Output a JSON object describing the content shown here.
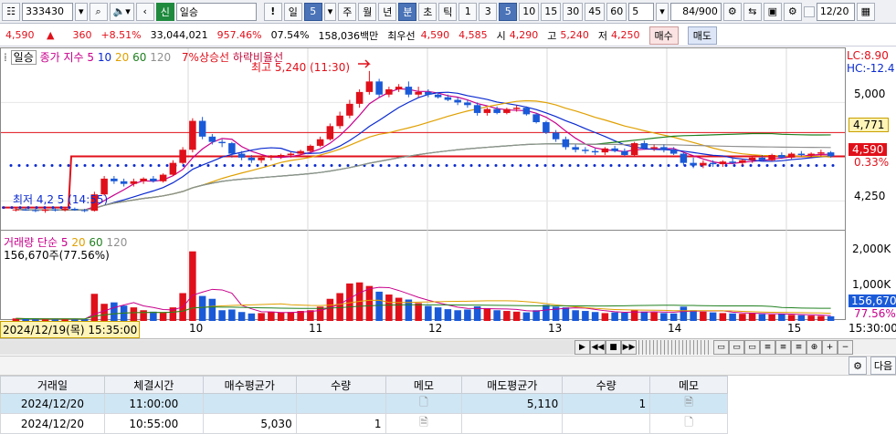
{
  "toolbar": {
    "code": "333430",
    "search_icon": "magnifier-icon",
    "market_badge": "신",
    "name": "일승",
    "period_label": "일",
    "period_value": "5",
    "tabs": [
      "주",
      "월",
      "년",
      "분",
      "초",
      "틱"
    ],
    "active_tab": "분",
    "intervals": [
      "1",
      "3",
      "5",
      "10",
      "15",
      "30",
      "45",
      "60"
    ],
    "active_interval": "5",
    "interval_value": "5",
    "count": "84",
    "count_total": "/900",
    "date": "12/20"
  },
  "priceline": {
    "price": "4,590",
    "change": "360",
    "change_pct": "+8.51%",
    "volume": "33,044,021",
    "volume_ratio": "957.46%",
    "turnover": "07.54%",
    "amount": "158,036백만",
    "best_label": "최우선",
    "best_sell": "4,590",
    "best_buy": "4,585",
    "open_label": "시",
    "open": "4,290",
    "high_label": "고",
    "high": "5,240",
    "low_label": "저",
    "low": "4,250",
    "buy_label": "매수",
    "sell_label": "매도"
  },
  "chart": {
    "name_label": "일승",
    "legend_main": "종가 지수",
    "ma_periods": [
      "5",
      "10",
      "20",
      "60",
      "120"
    ],
    "ma_colors": [
      "#c8008c",
      "#0a2ad0",
      "#e0a000",
      "#208020",
      "#909090"
    ],
    "signal_label": "7%상승선",
    "signal2_label": "하락비율선",
    "high_annotation": "최고 5,240 (11:30)",
    "low_annotation": "최저 4,2 5 (14:55)",
    "lc_label": "LC:8.90",
    "hc_label": "HC:-12.4",
    "y_ticks": [
      "5,000",
      "4,250"
    ],
    "price_tag_1": "4,771",
    "price_tag_2": "4,590",
    "pct_tag": "0.33%",
    "volume_legend": "거래량 단순",
    "volume_periods": [
      "5",
      "20",
      "60",
      "120"
    ],
    "volume_info": "156,670주(77.56%)",
    "volume_ticks": [
      "2,000K",
      "1,000K"
    ],
    "volume_tag": "156,670",
    "volume_pct_tag": "77.56%",
    "cursor_datetime": "2024/12/19(목) 15:35:00",
    "x_dates": [
      "10",
      "11",
      "12",
      "13",
      "14",
      "15"
    ],
    "time_tag": "15:30:00",
    "up_color": "#e0101a",
    "down_color": "#1a5ad8"
  },
  "chart_data": {
    "type": "candlestick",
    "candles": [
      [
        4180,
        4195,
        4170,
        4185
      ],
      [
        4185,
        4200,
        4175,
        4180
      ],
      [
        4180,
        4190,
        4165,
        4175
      ],
      [
        4175,
        4190,
        4160,
        4185
      ],
      [
        4185,
        4195,
        4170,
        4180
      ],
      [
        4180,
        4195,
        4170,
        4190
      ],
      [
        4190,
        4200,
        4175,
        4180
      ],
      [
        4180,
        4190,
        4165,
        4175
      ],
      [
        4175,
        4320,
        4170,
        4300
      ],
      [
        4300,
        4440,
        4290,
        4420
      ],
      [
        4420,
        4440,
        4380,
        4400
      ],
      [
        4400,
        4420,
        4360,
        4380
      ],
      [
        4380,
        4420,
        4360,
        4400
      ],
      [
        4400,
        4430,
        4380,
        4420
      ],
      [
        4420,
        4440,
        4390,
        4400
      ],
      [
        4400,
        4460,
        4390,
        4450
      ],
      [
        4450,
        4560,
        4440,
        4540
      ],
      [
        4540,
        4660,
        4530,
        4640
      ],
      [
        4640,
        4880,
        4620,
        4860
      ],
      [
        4860,
        4890,
        4720,
        4740
      ],
      [
        4740,
        4760,
        4680,
        4700
      ],
      [
        4700,
        4720,
        4660,
        4690
      ],
      [
        4690,
        4700,
        4580,
        4610
      ],
      [
        4610,
        4630,
        4560,
        4580
      ],
      [
        4580,
        4600,
        4540,
        4560
      ],
      [
        4560,
        4590,
        4540,
        4580
      ],
      [
        4580,
        4600,
        4560,
        4590
      ],
      [
        4590,
        4610,
        4570,
        4600
      ],
      [
        4600,
        4620,
        4580,
        4610
      ],
      [
        4610,
        4640,
        4600,
        4630
      ],
      [
        4630,
        4680,
        4620,
        4670
      ],
      [
        4670,
        4740,
        4660,
        4720
      ],
      [
        4720,
        4840,
        4710,
        4820
      ],
      [
        4820,
        4930,
        4800,
        4900
      ],
      [
        4900,
        5020,
        4880,
        4990
      ],
      [
        4990,
        5100,
        4960,
        5080
      ],
      [
        5080,
        5240,
        5060,
        5160
      ],
      [
        5160,
        5180,
        5040,
        5060
      ],
      [
        5060,
        5120,
        5040,
        5100
      ],
      [
        5100,
        5140,
        5080,
        5120
      ],
      [
        5120,
        5160,
        5040,
        5060
      ],
      [
        5060,
        5120,
        5040,
        5080
      ],
      [
        5080,
        5100,
        5040,
        5060
      ],
      [
        5060,
        5080,
        5030,
        5040
      ],
      [
        5040,
        5060,
        5010,
        5020
      ],
      [
        5020,
        5040,
        4980,
        5000
      ],
      [
        5000,
        5020,
        4960,
        4980
      ],
      [
        4980,
        5000,
        4900,
        4920
      ],
      [
        4920,
        4960,
        4900,
        4950
      ],
      [
        4950,
        4970,
        4910,
        4920
      ],
      [
        4920,
        4960,
        4910,
        4950
      ],
      [
        4950,
        4980,
        4930,
        4960
      ],
      [
        4960,
        4970,
        4900,
        4910
      ],
      [
        4910,
        4920,
        4840,
        4850
      ],
      [
        4850,
        4860,
        4760,
        4770
      ],
      [
        4770,
        4790,
        4700,
        4720
      ],
      [
        4720,
        4740,
        4640,
        4660
      ],
      [
        4660,
        4680,
        4620,
        4640
      ],
      [
        4640,
        4660,
        4610,
        4630
      ],
      [
        4630,
        4650,
        4600,
        4620
      ],
      [
        4620,
        4660,
        4600,
        4650
      ],
      [
        4650,
        4670,
        4620,
        4630
      ],
      [
        4630,
        4650,
        4590,
        4600
      ],
      [
        4600,
        4700,
        4590,
        4690
      ],
      [
        4690,
        4710,
        4640,
        4650
      ],
      [
        4650,
        4680,
        4630,
        4660
      ],
      [
        4660,
        4680,
        4620,
        4640
      ],
      [
        4640,
        4660,
        4600,
        4610
      ],
      [
        4610,
        4620,
        4520,
        4540
      ],
      [
        4540,
        4580,
        4500,
        4520
      ],
      [
        4520,
        4560,
        4500,
        4540
      ],
      [
        4540,
        4560,
        4510,
        4530
      ],
      [
        4530,
        4560,
        4510,
        4550
      ],
      [
        4550,
        4580,
        4530,
        4540
      ],
      [
        4540,
        4570,
        4520,
        4560
      ],
      [
        4560,
        4590,
        4540,
        4580
      ],
      [
        4580,
        4600,
        4550,
        4560
      ],
      [
        4560,
        4610,
        4550,
        4600
      ],
      [
        4600,
        4620,
        4570,
        4580
      ],
      [
        4580,
        4620,
        4570,
        4610
      ],
      [
        4610,
        4630,
        4590,
        4600
      ],
      [
        4600,
        4620,
        4580,
        4610
      ],
      [
        4610,
        4640,
        4590,
        4620
      ],
      [
        4620,
        4630,
        4580,
        4590
      ]
    ],
    "volumes": [
      70,
      60,
      55,
      50,
      45,
      60,
      55,
      50,
      760,
      480,
      520,
      430,
      380,
      300,
      260,
      230,
      380,
      780,
      1950,
      700,
      620,
      300,
      320,
      250,
      210,
      220,
      260,
      240,
      250,
      280,
      300,
      400,
      620,
      780,
      1050,
      1080,
      980,
      820,
      740,
      650,
      600,
      500,
      420,
      380,
      330,
      300,
      320,
      410,
      360,
      300,
      280,
      260,
      240,
      300,
      450,
      400,
      380,
      300,
      280,
      250,
      220,
      240,
      230,
      300,
      260,
      240,
      220,
      210,
      400,
      300,
      260,
      240,
      220,
      210,
      200,
      220,
      190,
      180,
      200,
      170,
      160,
      150,
      140,
      130
    ],
    "hline_main": 4590,
    "hline_upper": 4771,
    "dotted_line": 4520,
    "dotted_line_low": 4200
  },
  "panel": {
    "button_label": "다음"
  },
  "table": {
    "headers": [
      "거래일",
      "체결시간",
      "매수평균가",
      "수량",
      "메모",
      "매도평균가",
      "수량",
      "메모"
    ],
    "rows": [
      [
        "2024/12/20",
        "11:00:00",
        "",
        "",
        "",
        "5,110",
        "1",
        ""
      ],
      [
        "2024/12/20",
        "10:55:00",
        "5,030",
        "1",
        "",
        "",
        "",
        ""
      ]
    ]
  }
}
